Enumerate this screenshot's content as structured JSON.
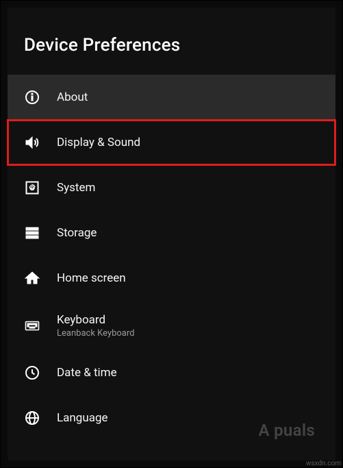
{
  "title": "Device Preferences",
  "items": [
    {
      "label": "About",
      "subtitle": null,
      "selected": true,
      "highlighted": false,
      "name": "menu-item-about",
      "icon": "info-icon"
    },
    {
      "label": "Display & Sound",
      "subtitle": null,
      "selected": false,
      "highlighted": true,
      "name": "menu-item-display",
      "icon": "speaker-icon"
    },
    {
      "label": "System",
      "subtitle": null,
      "selected": false,
      "highlighted": false,
      "name": "menu-item-system",
      "icon": "system-icon"
    },
    {
      "label": "Storage",
      "subtitle": null,
      "selected": false,
      "highlighted": false,
      "name": "menu-item-storage",
      "icon": "storage-icon"
    },
    {
      "label": "Home screen",
      "subtitle": null,
      "selected": false,
      "highlighted": false,
      "name": "menu-item-home",
      "icon": "home-icon"
    },
    {
      "label": "Keyboard",
      "subtitle": "Leanback Keyboard",
      "selected": false,
      "highlighted": false,
      "name": "menu-item-keyboard",
      "icon": "keyboard-icon"
    },
    {
      "label": "Date & time",
      "subtitle": null,
      "selected": false,
      "highlighted": false,
      "name": "menu-item-datetime",
      "icon": "clock-icon"
    },
    {
      "label": "Language",
      "subtitle": null,
      "selected": false,
      "highlighted": false,
      "name": "menu-item-language",
      "icon": "globe-icon"
    }
  ],
  "watermark_appuals": "A  puals",
  "watermark_wsxdn": "wsxdn.com"
}
